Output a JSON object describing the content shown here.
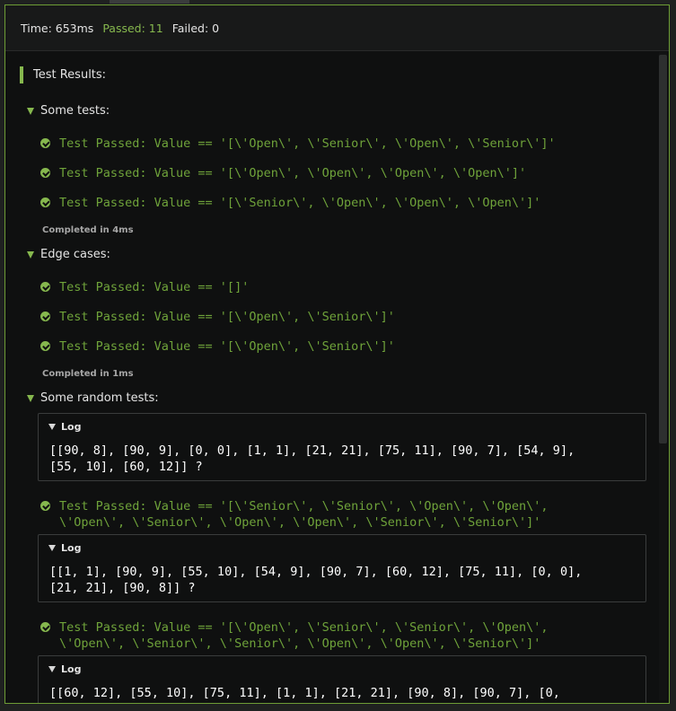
{
  "summary": {
    "time": "Time: 653ms",
    "passed": "Passed: 11",
    "failed": "Failed: 0"
  },
  "results_title": "Test Results:",
  "groups": [
    {
      "title": "Some tests:",
      "items": [
        "Test Passed: Value == '[\\'Open\\', \\'Senior\\', \\'Open\\', \\'Senior\\']'",
        "Test Passed: Value == '[\\'Open\\', \\'Open\\', \\'Open\\', \\'Open\\']'",
        "Test Passed: Value == '[\\'Senior\\', \\'Open\\', \\'Open\\', \\'Open\\']'"
      ],
      "completed": "Completed in 4ms"
    },
    {
      "title": "Edge cases:",
      "items": [
        "Test Passed: Value == '[]'",
        "Test Passed: Value == '[\\'Open\\', \\'Senior\\']'",
        "Test Passed: Value == '[\\'Open\\', \\'Senior\\']'"
      ],
      "completed": "Completed in 1ms"
    },
    {
      "title": "Some random tests:",
      "logs": [
        {
          "label": "Log",
          "text": "[[90, 8], [90, 9], [0, 0], [1, 1], [21, 21], [75, 11], [90, 7], [54, 9],\n[55, 10], [60, 12]] ?"
        },
        {
          "label": "Log",
          "text": "[[1, 1], [90, 9], [55, 10], [54, 9], [90, 7], [60, 12], [75, 11], [0, 0],\n[21, 21], [90, 8]] ?"
        },
        {
          "label": "Log",
          "text": "[[60, 12], [55, 10], [75, 11], [1, 1], [21, 21], [90, 8], [90, 7], [0,"
        }
      ],
      "items": [
        "Test Passed: Value == '[\\'Senior\\', \\'Senior\\', \\'Open\\', \\'Open\\',\n\\'Open\\', \\'Senior\\', \\'Open\\', \\'Open\\', \\'Senior\\', \\'Senior\\']'",
        "Test Passed: Value == '[\\'Open\\', \\'Senior\\', \\'Senior\\', \\'Open\\',\n\\'Open\\', \\'Senior\\', \\'Senior\\', \\'Open\\', \\'Open\\', \\'Senior\\']'"
      ]
    }
  ],
  "colors": {
    "accent": "#86b84e",
    "pass_text": "#6fa33a",
    "background": "#0f1010"
  }
}
